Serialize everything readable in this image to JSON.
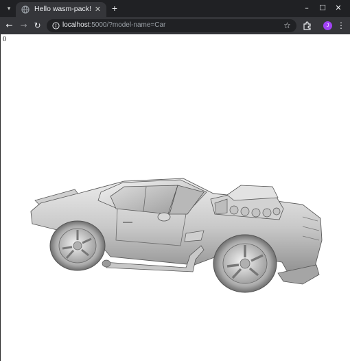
{
  "browser": {
    "tab": {
      "title": "Hello wasm-pack!"
    },
    "address": {
      "host": "localhost",
      "rest": ":5000/?model-name=Car"
    },
    "profile_initial": "J",
    "accent_colors": {
      "chrome_dark": "#202124",
      "chrome_toolbar": "#35363a",
      "profile": "#a142f4"
    }
  },
  "page": {
    "output_text": "0",
    "viewport": {
      "model": "car",
      "description_icon": "car-render"
    }
  }
}
